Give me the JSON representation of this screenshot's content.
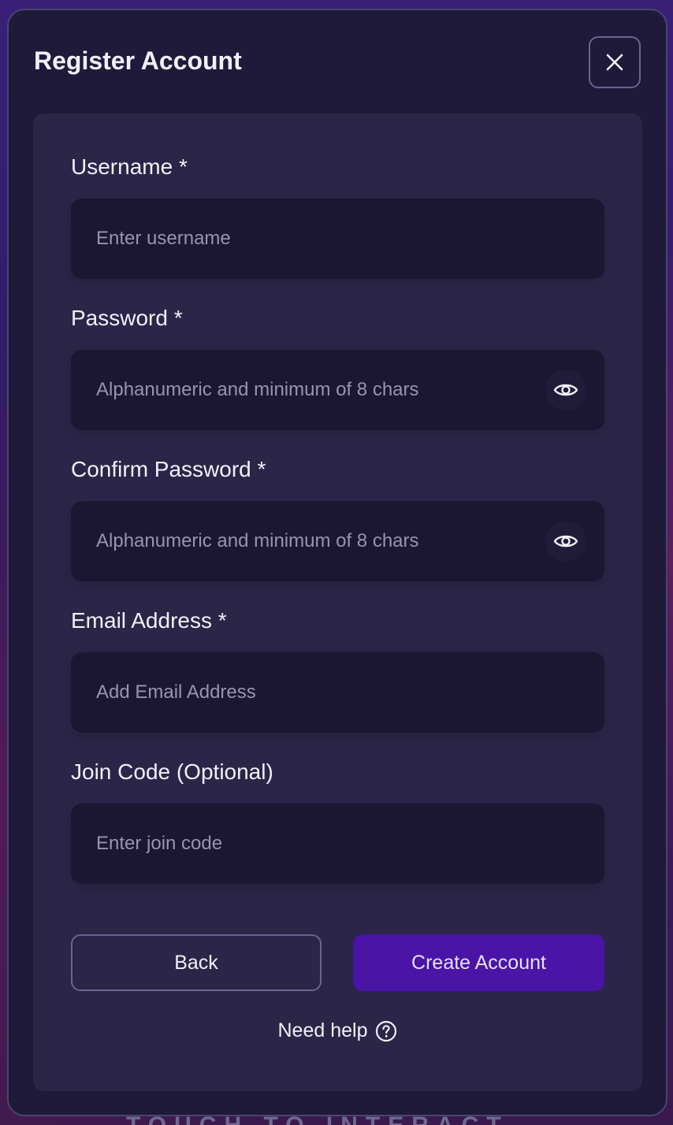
{
  "background": {
    "hint_text": "TOUCH TO INTERACT"
  },
  "modal": {
    "title": "Register Account",
    "close_icon": "close-icon"
  },
  "form": {
    "fields": [
      {
        "label": "Username *",
        "placeholder": "Enter username",
        "value": "",
        "type": "text",
        "has_visibility_toggle": false
      },
      {
        "label": "Password *",
        "placeholder": "Alphanumeric and minimum of 8 chars",
        "value": "",
        "type": "password",
        "has_visibility_toggle": true,
        "toggle_icon": "eye-icon"
      },
      {
        "label": "Confirm Password *",
        "placeholder": "Alphanumeric and minimum of 8 chars",
        "value": "",
        "type": "password",
        "has_visibility_toggle": true,
        "toggle_icon": "eye-icon"
      },
      {
        "label": "Email Address *",
        "placeholder": "Add Email Address",
        "value": "",
        "type": "email",
        "has_visibility_toggle": false
      },
      {
        "label": "Join Code (Optional)",
        "placeholder": "Enter join code",
        "value": "",
        "type": "text",
        "has_visibility_toggle": false
      }
    ],
    "back_label": "Back",
    "create_label": "Create Account",
    "help_label": "Need help",
    "help_icon": "help-circle-icon"
  },
  "colors": {
    "accent": "#4a14a6",
    "modal_bg": "#1f1a3a",
    "card_bg": "#2b2548",
    "input_bg": "#1b1632",
    "text": "#f1f0f8",
    "placeholder": "#9893ae"
  }
}
